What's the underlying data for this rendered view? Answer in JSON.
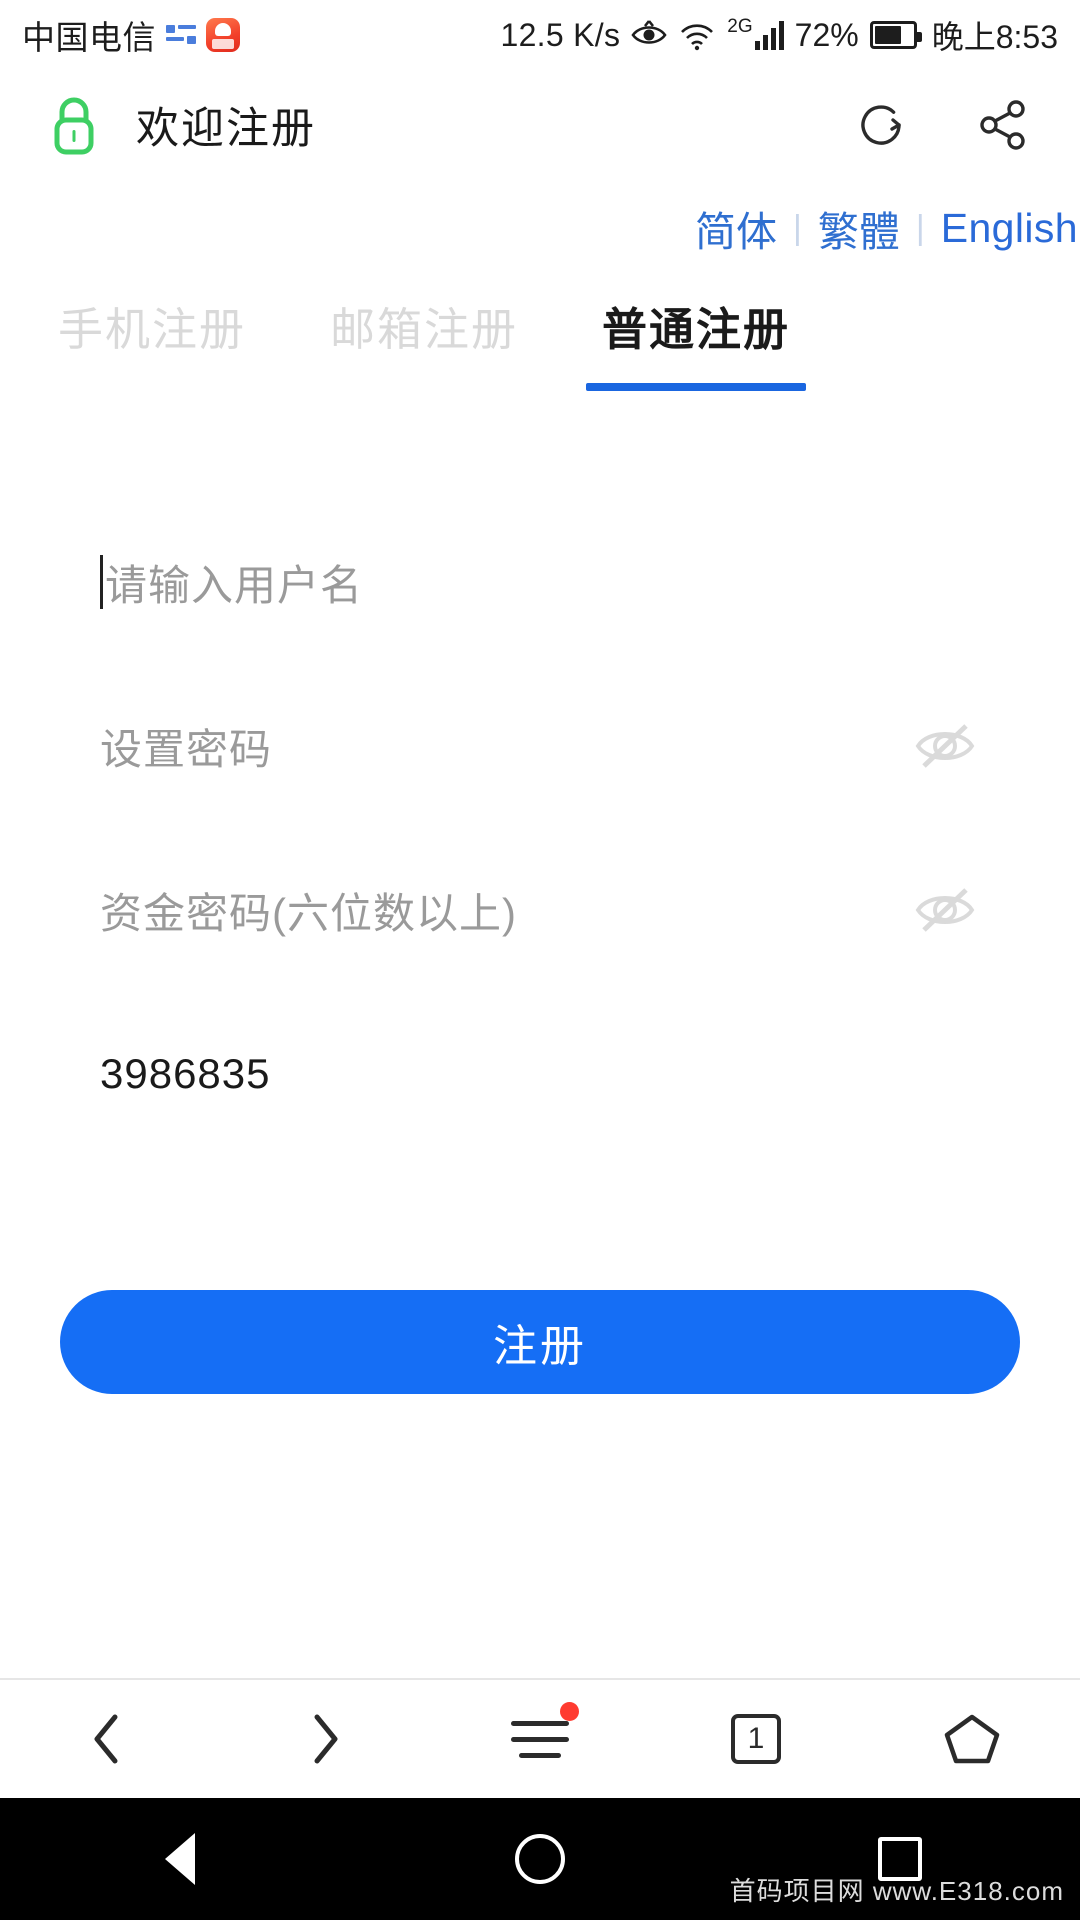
{
  "status_bar": {
    "carrier": "中国电信",
    "signal_dots_icon": "data-transfer-icon",
    "app_badge_icon": "app-notification-icon",
    "network_speed": "12.5 K/s",
    "eye_icon": "eye-care-icon",
    "wifi_icon": "wifi-icon",
    "network_type": "2G",
    "signal_icon": "signal-bars-icon",
    "battery_percent": "72%",
    "battery_icon": "battery-icon",
    "battery_level": 72,
    "time": "晚上8:53"
  },
  "app_bar": {
    "lock_icon": "lock-icon",
    "lock_color": "#3ecf63",
    "title": "欢迎注册",
    "refresh_icon": "refresh-icon",
    "share_icon": "share-icon"
  },
  "language": {
    "items": [
      {
        "label": "简体",
        "name": "lang-simplified"
      },
      {
        "label": "繁體",
        "name": "lang-traditional"
      },
      {
        "label": "English",
        "name": "lang-english"
      }
    ],
    "separator": "|",
    "link_color": "#2f6fd0"
  },
  "tabs": [
    {
      "label": "手机注册",
      "active": false
    },
    {
      "label": "邮箱注册",
      "active": false
    },
    {
      "label": "普通注册",
      "active": true
    }
  ],
  "tab_underline_color": "#1a66e0",
  "form": {
    "username": {
      "placeholder": "请输入用户名",
      "value": "",
      "focused": true
    },
    "password": {
      "placeholder": "设置密码",
      "value": "",
      "toggle_icon": "eye-off-icon"
    },
    "fund_password": {
      "placeholder": "资金密码(六位数以上)",
      "value": "",
      "toggle_icon": "eye-off-icon"
    },
    "invite_code": {
      "placeholder": "",
      "value": "3986835"
    }
  },
  "submit": {
    "label": "注册",
    "color": "#156ef5"
  },
  "browser_bar": {
    "back_icon": "chevron-left-icon",
    "forward_icon": "chevron-right-icon",
    "menu_icon": "hamburger-menu-icon",
    "menu_badge": true,
    "tab_count": "1",
    "home_icon": "home-pentagon-icon"
  },
  "android_nav": {
    "back_icon": "triangle-back-icon",
    "home_icon": "circle-home-icon",
    "recents_icon": "square-recents-icon"
  },
  "watermark": "首码项目网  www.E318.com"
}
